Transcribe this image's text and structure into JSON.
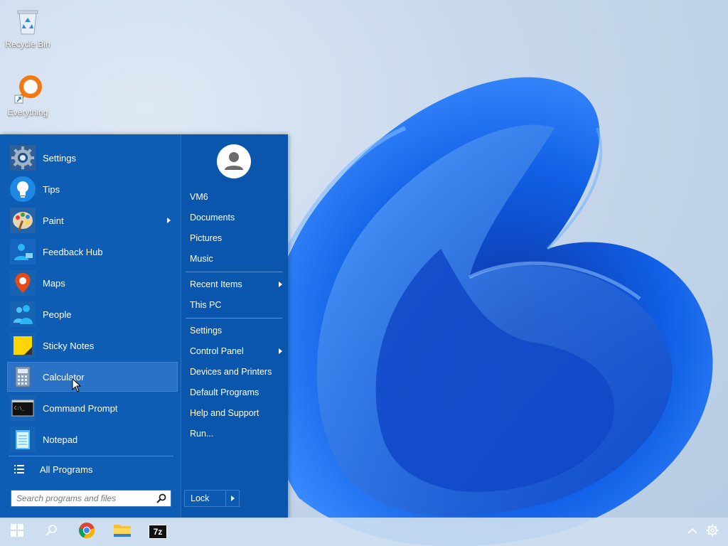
{
  "desktop": {
    "icons": [
      {
        "label": "Recycle Bin",
        "icon": "recycle-bin-icon"
      },
      {
        "label": "Everything",
        "icon": "everything-search-icon"
      }
    ]
  },
  "start_menu": {
    "programs": [
      {
        "label": "Settings",
        "icon": "gear-icon"
      },
      {
        "label": "Tips",
        "icon": "lightbulb-icon"
      },
      {
        "label": "Paint",
        "icon": "palette-icon",
        "has_submenu": true
      },
      {
        "label": "Feedback Hub",
        "icon": "feedback-person-icon"
      },
      {
        "label": "Maps",
        "icon": "map-pin-icon"
      },
      {
        "label": "People",
        "icon": "people-icon"
      },
      {
        "label": "Sticky Notes",
        "icon": "sticky-note-icon"
      },
      {
        "label": "Calculator",
        "icon": "calculator-icon",
        "highlighted": true
      },
      {
        "label": "Command Prompt",
        "icon": "terminal-icon"
      },
      {
        "label": "Notepad",
        "icon": "notepad-icon"
      }
    ],
    "all_programs_label": "All Programs",
    "search": {
      "placeholder": "Search programs and files"
    },
    "right": {
      "user": "VM6",
      "links_group1": [
        "Documents",
        "Pictures",
        "Music"
      ],
      "recent_items": "Recent Items",
      "this_pc": "This PC",
      "settings": "Settings",
      "control_panel": "Control Panel",
      "devices_printers": "Devices and Printers",
      "default_programs": "Default Programs",
      "help_support": "Help and Support",
      "run": "Run...",
      "lock": "Lock"
    }
  },
  "taskbar": {
    "items": [
      "start-icon",
      "search-icon",
      "chrome-icon",
      "file-explorer-icon",
      "7zip-icon"
    ],
    "sevenzip_label": "7z",
    "tray": [
      "chevron-up-icon",
      "gear-icon"
    ]
  },
  "colors": {
    "menu_bg": "#0d5db5",
    "menu_highlight": "#2a72c6",
    "taskbar_bg": "#cddef0"
  }
}
